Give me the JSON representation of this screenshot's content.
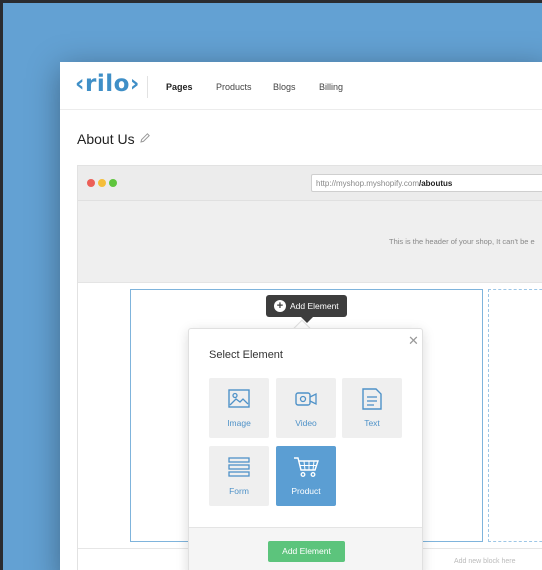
{
  "app": {
    "logo": "‹rilo›",
    "nav": [
      {
        "label": "Pages",
        "active": true
      },
      {
        "label": "Products",
        "active": false
      },
      {
        "label": "Blogs",
        "active": false
      },
      {
        "label": "Billing",
        "active": false
      }
    ]
  },
  "page": {
    "title": "About Us",
    "edit_icon": "pencil-icon"
  },
  "browser": {
    "url_prefix": "http://myshop.myshopify.com",
    "url_path": "/aboutus",
    "window_dots": [
      "#ec5f57",
      "#f5be3a",
      "#5fc53d"
    ]
  },
  "shop": {
    "header_note": "This is the header of your shop, It can't be e",
    "footer_note": "Add new block here"
  },
  "add_element_chip": {
    "label": "Add Element",
    "icon": "plus-circle-icon"
  },
  "popover": {
    "title": "Select Element",
    "close_icon": "close-icon",
    "elements": [
      {
        "label": "Image",
        "icon": "image-icon"
      },
      {
        "label": "Video",
        "icon": "video-icon"
      },
      {
        "label": "Text",
        "icon": "text-document-icon"
      },
      {
        "label": "Form",
        "icon": "form-icon"
      },
      {
        "label": "Product",
        "icon": "cart-icon",
        "selected": true
      }
    ],
    "button_label": "Add Element"
  },
  "colors": {
    "accent": "#4f92c8",
    "selected_tile": "#5b9ed3",
    "add_button": "#5cc47c",
    "background": "#63a1d3"
  }
}
